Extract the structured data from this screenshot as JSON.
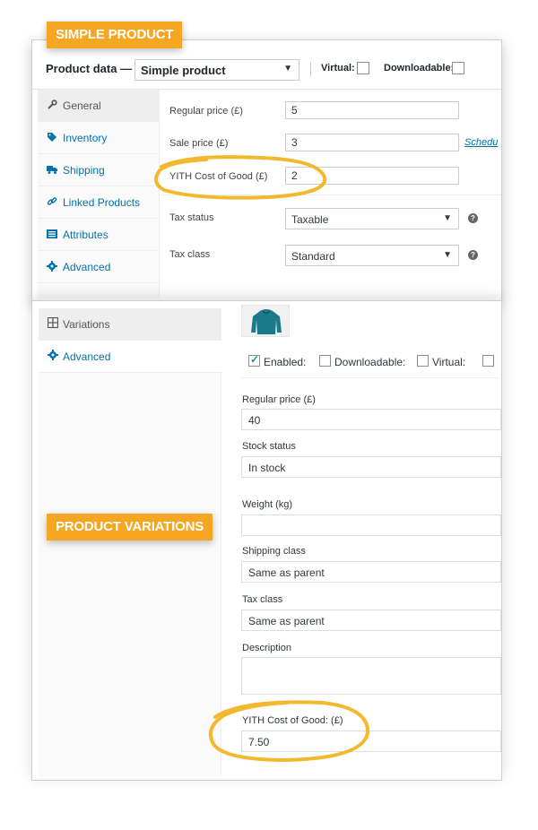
{
  "badges": {
    "simple_product": "SIMPLE PRODUCT",
    "product_variations": "PRODUCT VARIATIONS"
  },
  "simple_product": {
    "header_title": "Product data —",
    "product_type": "Simple product",
    "virtual_label": "Virtual:",
    "downloadable_label": "Downloadable:",
    "tabs": [
      {
        "label": "General",
        "icon": "wrench-icon"
      },
      {
        "label": "Inventory",
        "icon": "tag-icon"
      },
      {
        "label": "Shipping",
        "icon": "truck-icon"
      },
      {
        "label": "Linked Products",
        "icon": "link-icon"
      },
      {
        "label": "Attributes",
        "icon": "list-icon"
      },
      {
        "label": "Advanced",
        "icon": "gear-icon"
      }
    ],
    "regular_price_label": "Regular price (£)",
    "regular_price_value": "5",
    "sale_price_label": "Sale price (£)",
    "sale_price_value": "3",
    "schedule_link": "Schedu",
    "cost_label": "YITH Cost of Good (£)",
    "cost_value": "2",
    "tax_status_label": "Tax status",
    "tax_status_value": "Taxable",
    "tax_class_label": "Tax class",
    "tax_class_value": "Standard"
  },
  "variations": {
    "tabs": [
      {
        "label": "Variations",
        "icon": "grid-icon"
      },
      {
        "label": "Advanced",
        "icon": "gear-icon"
      }
    ],
    "enabled_label": "Enabled:",
    "downloadable_label": "Downloadable:",
    "virtual_label": "Virtual:",
    "regular_price_label": "Regular price (£)",
    "regular_price_value": "40",
    "stock_status_label": "Stock status",
    "stock_status_value": "In stock",
    "weight_label": "Weight (kg)",
    "weight_value": "",
    "shipping_class_label": "Shipping class",
    "shipping_class_value": "Same as parent",
    "tax_class_label": "Tax class",
    "tax_class_value": "Same as parent",
    "description_label": "Description",
    "description_value": "",
    "cost_label": "YITH Cost of Good: (£)",
    "cost_value": "7.50"
  },
  "colors": {
    "badge": "#f5a623",
    "highlight_circle": "#f3b92e",
    "link": "#0073aa"
  }
}
